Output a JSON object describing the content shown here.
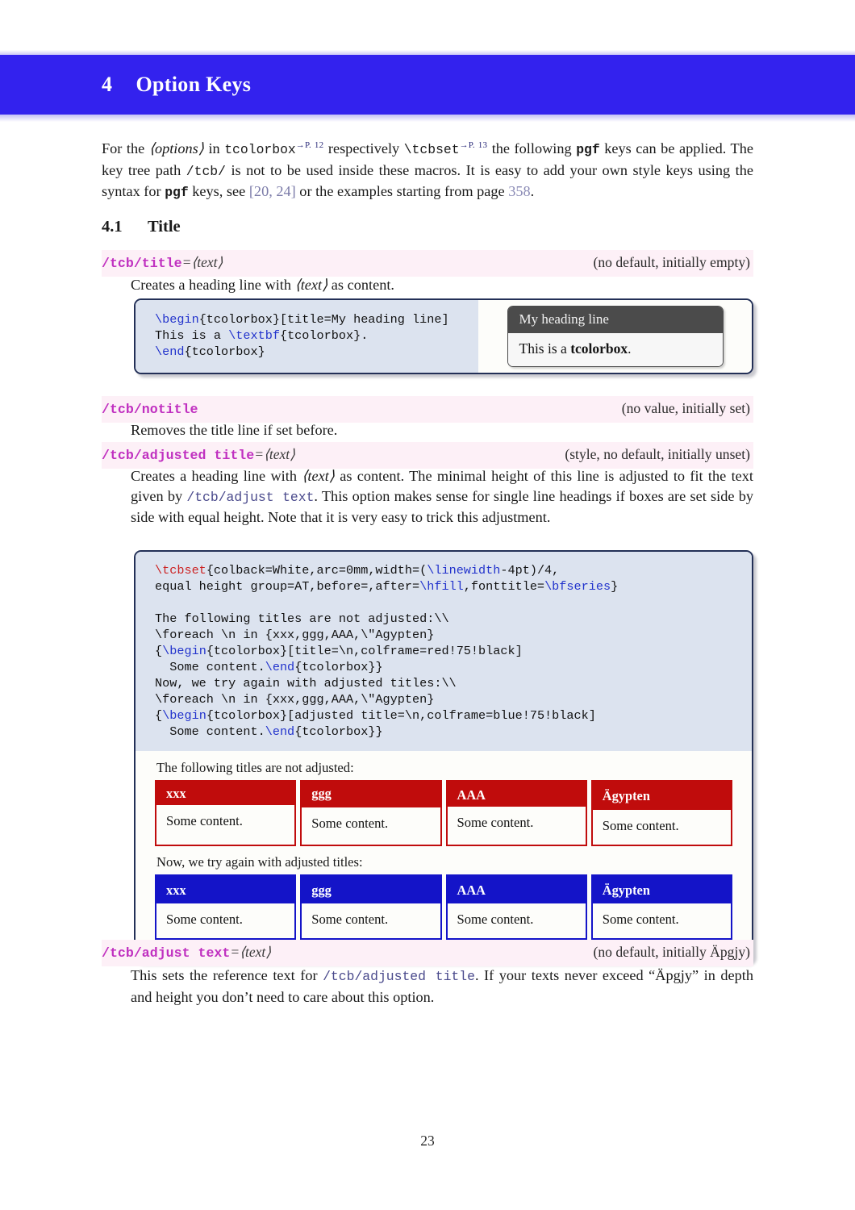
{
  "chapter": {
    "number": "4",
    "title": "Option Keys"
  },
  "intro": {
    "t1": "For the ",
    "options": "⟨options⟩",
    "t2": " in ",
    "tcolorbox": "tcolorbox",
    "ref1": "→P. 12",
    "t3": " respectively ",
    "tcbset": "\\tcbset",
    "ref2": "→P. 13",
    "t4": " the following ",
    "pgf1": "pgf",
    "t5": " keys can be applied. The key tree path ",
    "tcbpath": "/tcb/",
    "t6": " is not to be used inside these macros. It is easy to add your own style keys using the syntax for ",
    "pgf2": "pgf",
    "t7": " keys, see ",
    "cite": "[20, 24]",
    "t8": " or the examples starting from page ",
    "pageref": "358",
    "t9": "."
  },
  "section": {
    "number": "4.1",
    "title": "Title"
  },
  "keys": [
    {
      "name": "/tcb/title",
      "arg": "=⟨text⟩",
      "spec": "(no default, initially empty)",
      "desc_pre": "Creates a heading line with ",
      "desc_arg": "⟨text⟩",
      "desc_post": " as content."
    },
    {
      "name": "/tcb/notitle",
      "arg": "",
      "spec": "(no value, initially set)",
      "desc": "Removes the title line if set before."
    },
    {
      "name": "/tcb/adjusted title",
      "arg": "=⟨text⟩",
      "spec": "(style, no default, initially unset)",
      "desc_a": "Creates a heading line with ",
      "desc_arg": "⟨text⟩",
      "desc_b": " as content. The minimal height of this line is adjusted to fit the text given by ",
      "refkey": "/tcb/adjust text",
      "desc_c": ". This option makes sense for single line headings if boxes are set side by side with equal height. Note that it is very easy to trick this adjustment."
    },
    {
      "name": "/tcb/adjust text",
      "arg": "=⟨text⟩",
      "spec": "(no default, initially Äpgjy)",
      "desc_a": "This sets the reference text for ",
      "refkey": "/tcb/adjusted title",
      "desc_b": ". If your texts never exceed “Äpgjy” in depth and height you don’t need to care about this option."
    }
  ],
  "example1": {
    "code_lines": [
      [
        {
          "t": "\\begin",
          "c": "blue"
        },
        {
          "t": "{tcolorbox}[title=My heading line]",
          "c": "black"
        }
      ],
      [
        {
          "t": "This is a ",
          "c": "black"
        },
        {
          "t": "\\textbf",
          "c": "blue"
        },
        {
          "t": "{tcolorbox}.",
          "c": "black"
        }
      ],
      [
        {
          "t": "\\end",
          "c": "blue"
        },
        {
          "t": "{tcolorbox}",
          "c": "black"
        }
      ]
    ],
    "demo": {
      "title": "My heading line",
      "body_pre": "This is a ",
      "body_bold": "tcolorbox",
      "body_post": "."
    }
  },
  "example2": {
    "code_lines": [
      [
        {
          "t": "\\tcbset",
          "c": "red"
        },
        {
          "t": "{colback=White,arc=0mm,width=(",
          "c": "black"
        },
        {
          "t": "\\linewidth",
          "c": "blue"
        },
        {
          "t": "-4pt)/4,",
          "c": "black"
        }
      ],
      [
        {
          "t": "equal height group=AT,before=,after=",
          "c": "black"
        },
        {
          "t": "\\hfill",
          "c": "blue"
        },
        {
          "t": ",fonttitle=",
          "c": "black"
        },
        {
          "t": "\\bfseries",
          "c": "blue"
        },
        {
          "t": "}",
          "c": "black"
        }
      ],
      [
        {
          "t": "",
          "c": "black"
        }
      ],
      [
        {
          "t": "The following titles are not adjusted:\\\\",
          "c": "black"
        }
      ],
      [
        {
          "t": "\\foreach \\n in {xxx,ggg,AAA,\\\"Agypten}",
          "c": "black"
        }
      ],
      [
        {
          "t": "{",
          "c": "black"
        },
        {
          "t": "\\begin",
          "c": "blue"
        },
        {
          "t": "{tcolorbox}[title=\\n,colframe=red!75!black]",
          "c": "black"
        }
      ],
      [
        {
          "t": "  Some content.",
          "c": "black"
        },
        {
          "t": "\\end",
          "c": "blue"
        },
        {
          "t": "{tcolorbox}}",
          "c": "black"
        }
      ],
      [
        {
          "t": "Now, we try again with adjusted titles:\\\\",
          "c": "black"
        }
      ],
      [
        {
          "t": "\\foreach \\n in {xxx,ggg,AAA,\\\"Agypten}",
          "c": "black"
        }
      ],
      [
        {
          "t": "{",
          "c": "black"
        },
        {
          "t": "\\begin",
          "c": "blue"
        },
        {
          "t": "{tcolorbox}[adjusted title=\\n,colframe=blue!75!black]",
          "c": "black"
        }
      ],
      [
        {
          "t": "  Some content.",
          "c": "black"
        },
        {
          "t": "\\end",
          "c": "blue"
        },
        {
          "t": "{tcolorbox}}",
          "c": "black"
        }
      ]
    ],
    "result": {
      "caption_unadjusted": "The following titles are not adjusted:",
      "caption_adjusted": "Now, we try again with adjusted titles:",
      "unadjusted_boxes": [
        {
          "title": "xxx",
          "body": "Some content.",
          "height_class": "t-short"
        },
        {
          "title": "ggg",
          "body": "Some content.",
          "height_class": "t-desc"
        },
        {
          "title": "AAA",
          "body": "Some content.",
          "height_class": "t-cap"
        },
        {
          "title": "Ägypten",
          "body": "Some content.",
          "height_class": "t-both"
        }
      ],
      "adjusted_boxes": [
        {
          "title": "xxx",
          "body": "Some content.",
          "height_class": "t-even"
        },
        {
          "title": "ggg",
          "body": "Some content.",
          "height_class": "t-even"
        },
        {
          "title": "AAA",
          "body": "Some content.",
          "height_class": "t-even"
        },
        {
          "title": "Ägypten",
          "body": "Some content.",
          "height_class": "t-even"
        }
      ]
    }
  },
  "footer": {
    "page_number": "23"
  },
  "colors": {
    "chapter_band": "#3322ee",
    "key_name": "#c030c0",
    "key_row_bg": "#fdf0f7",
    "code_bg": "#dce3ef",
    "box_frame": "#233057",
    "red_frame": "#c00c0c",
    "blue_frame": "#1414c8",
    "demo_title_bg": "#4b4b4b"
  }
}
